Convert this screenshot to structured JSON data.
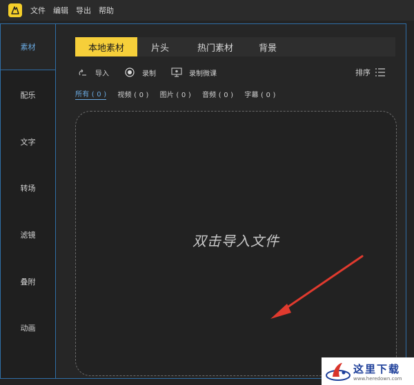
{
  "menubar": {
    "logo_icon": "app-logo-icon",
    "items": [
      "文件",
      "编辑",
      "导出",
      "帮助"
    ]
  },
  "sidebar": {
    "items": [
      "素材",
      "配乐",
      "文字",
      "转场",
      "滤镜",
      "叠附",
      "动画"
    ],
    "active_index": 0
  },
  "tabs": {
    "items": [
      "本地素材",
      "片头",
      "热门素材",
      "背景"
    ],
    "active_index": 0
  },
  "toolbar": {
    "import_label": "导入",
    "record_label": "录制",
    "record_lesson_label": "录制微课",
    "sort_label": "排序"
  },
  "filters": {
    "items": [
      "所有 ( 0 )",
      "视频 ( 0 )",
      "图片 ( 0 )",
      "音频 ( 0 )",
      "字幕 ( 0 )"
    ],
    "active_index": 0
  },
  "dropzone": {
    "hint": "双击导入文件"
  },
  "watermark": {
    "title": "这里下载",
    "url": "www.heredown.com"
  },
  "colors": {
    "accent_yellow": "#f6cf3a",
    "accent_blue": "#6aa9e0",
    "border_blue": "#2f6fa8",
    "arrow_red": "#e03a2e"
  }
}
